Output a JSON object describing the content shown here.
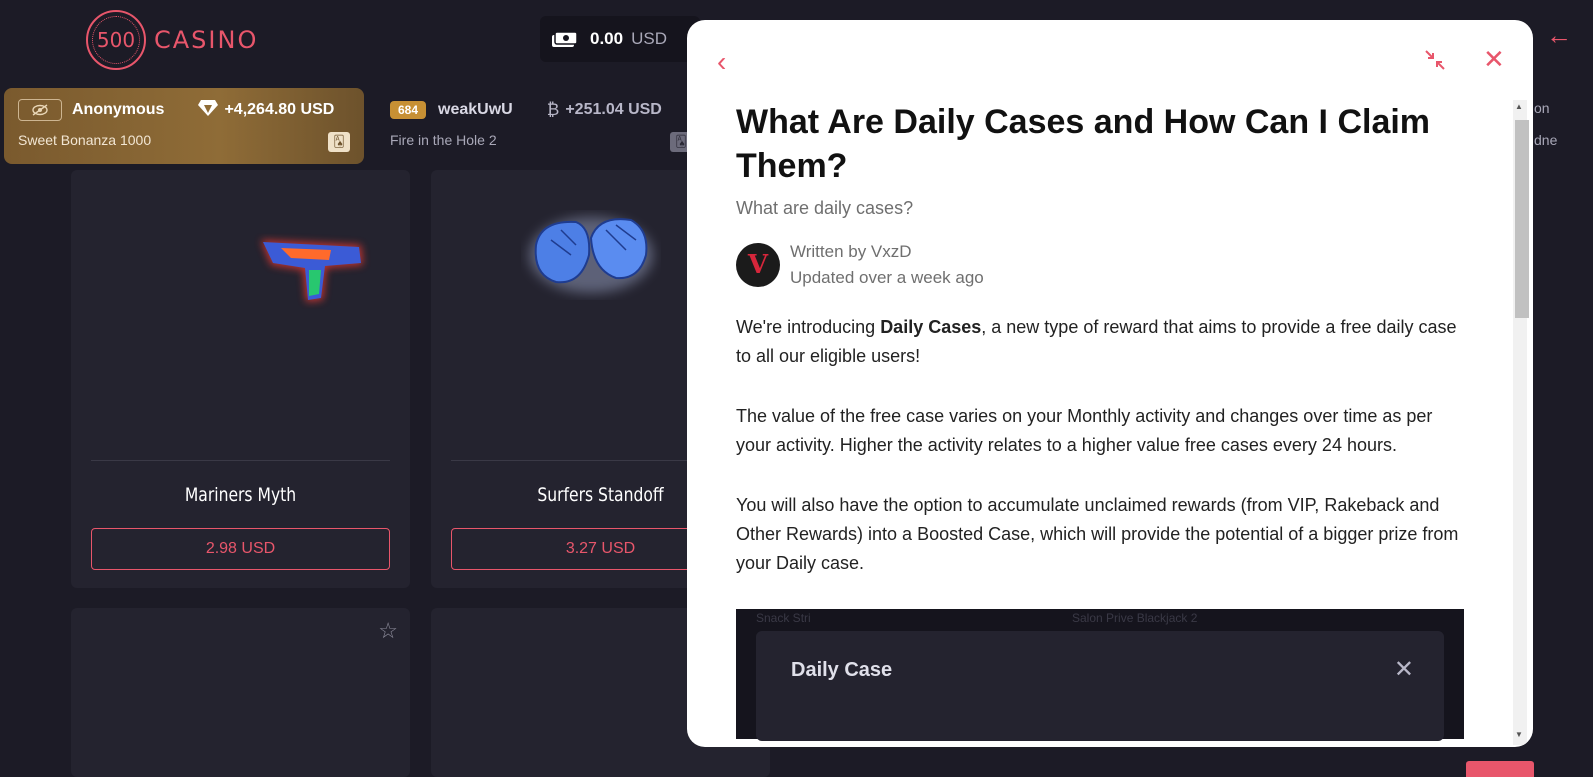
{
  "header": {
    "logo_number": "500",
    "logo_text": "CASINO",
    "balance_amount": "0.00",
    "balance_currency": "USD"
  },
  "wins": [
    {
      "user": "Anonymous",
      "amount": "+4,264.80",
      "currency": "USD",
      "game": "Sweet Bonanza 1000"
    },
    {
      "level": "684",
      "user": "weakUwU",
      "amount": "+251.04",
      "currency": "USD",
      "game": "Fire in the Hole 2"
    }
  ],
  "cases": [
    {
      "name": "Mariners Myth",
      "price": "2.98 USD"
    },
    {
      "name": "Surfers Standoff",
      "price": "3.27 USD"
    }
  ],
  "modal": {
    "title": "What Are Daily Cases and How Can I Claim Them?",
    "subtitle": "What are daily cases?",
    "author_line": "Written by VxzD",
    "updated_line": "Updated over a week ago",
    "p1_before": "We're introducing ",
    "p1_bold": "Daily Cases",
    "p1_after": ", a new type of reward that aims to provide a free daily case  to all our eligible users!",
    "p2": "The value of the free case varies on your Monthly activity and changes over time as per your activity. Higher the activity relates to a higher value free cases every 24 hours.",
    "p3": "You will also have the option to accumulate unclaimed rewards (from VIP, Rakeback and Other Rewards) into a Boosted Case, which will provide the potential of a bigger prize from your Daily case.",
    "embed_title": "Daily Case",
    "embed_faint_left": "Snack Stri",
    "embed_faint_right": "Salon Prive Blackjack 2"
  },
  "edge": {
    "top_text": "on",
    "bottom_text": "dne"
  },
  "colors": {
    "accent": "#e8566b",
    "background": "#1c1b26",
    "card": "#24232f",
    "gold": "#8f6c37"
  }
}
